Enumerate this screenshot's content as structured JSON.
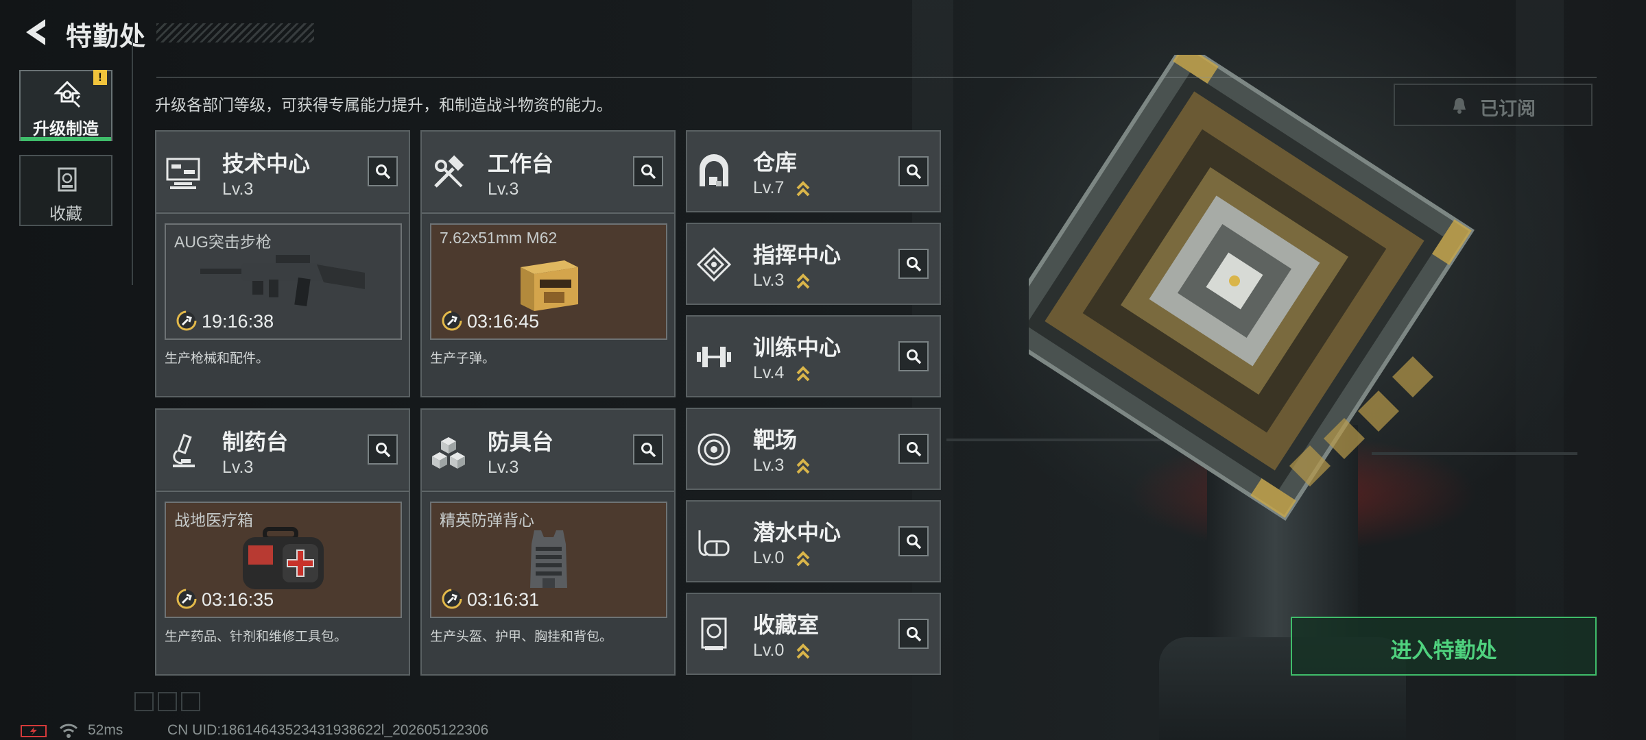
{
  "header": {
    "title": "特勤处"
  },
  "sidebar": {
    "tabs": [
      {
        "label": "升级制造",
        "badge": "!"
      },
      {
        "label": "收藏"
      }
    ]
  },
  "description": "升级各部门等级，可获得专属能力提升，和制造战斗物资的能力。",
  "subscribe": {
    "label": "已订阅"
  },
  "production_cards": [
    {
      "name": "技术中心",
      "level": "Lv.3",
      "product": "AUG突击步枪",
      "time": "19:16:38",
      "desc": "生产枪械和配件。"
    },
    {
      "name": "工作台",
      "level": "Lv.3",
      "product": "7.62x51mm M62",
      "time": "03:16:45",
      "desc": "生产子弹。"
    },
    {
      "name": "制药台",
      "level": "Lv.3",
      "product": "战地医疗箱",
      "time": "03:16:35",
      "desc": "生产药品、针剂和维修工具包。"
    },
    {
      "name": "防具台",
      "level": "Lv.3",
      "product": "精英防弹背心",
      "time": "03:16:31",
      "desc": "生产头盔、护甲、胸挂和背包。"
    }
  ],
  "facility_cards": [
    {
      "name": "仓库",
      "level": "Lv.7"
    },
    {
      "name": "指挥中心",
      "level": "Lv.3"
    },
    {
      "name": "训练中心",
      "level": "Lv.4"
    },
    {
      "name": "靶场",
      "level": "Lv.3"
    },
    {
      "name": "潜水中心",
      "level": "Lv.0"
    },
    {
      "name": "收藏室",
      "level": "Lv.0"
    }
  ],
  "enter_button": {
    "label": "进入特勤处"
  },
  "status": {
    "ping": "52ms",
    "uid": "CN UID:18614643523431938622l_202605122306"
  },
  "colors": {
    "accent_green": "#3fbd6a",
    "gold": "#d9b54a",
    "badge_yellow": "#f0c43c"
  },
  "icons": [
    "back-arrow-icon",
    "upgrade-icon",
    "collection-icon",
    "computer-icon",
    "hammer-wrench-icon",
    "warehouse-icon",
    "command-icon",
    "dumbbell-icon",
    "target-icon",
    "microscope-icon",
    "armor-blocks-icon",
    "diving-mask-icon",
    "collection-room-icon",
    "search-icon",
    "clock-wrench-icon",
    "bell-icon",
    "battery-icon",
    "wifi-icon"
  ]
}
